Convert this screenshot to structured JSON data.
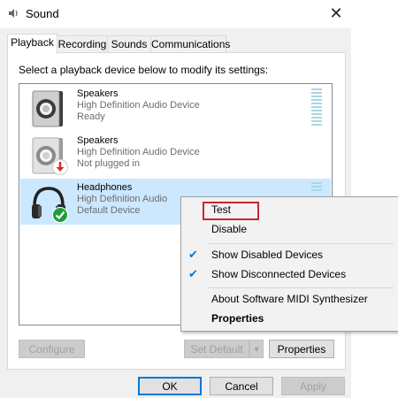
{
  "window": {
    "title": "Sound",
    "close_label": "✕"
  },
  "tabs": [
    {
      "label": "Playback",
      "active": true
    },
    {
      "label": "Recording",
      "active": false
    },
    {
      "label": "Sounds",
      "active": false
    },
    {
      "label": "Communications",
      "active": false
    }
  ],
  "instruction": "Select a playback device below to modify its settings:",
  "devices": [
    {
      "name": "Speakers",
      "description": "High Definition Audio Device",
      "status": "Ready",
      "icon": "speaker-icon",
      "selected": false
    },
    {
      "name": "Speakers",
      "description": "High Definition Audio Device",
      "status": "Not plugged in",
      "icon": "speaker-unplugged-icon",
      "badge": "down-arrow-badge",
      "selected": false
    },
    {
      "name": "Headphones",
      "description": "High Definition Audio",
      "status": "Default Device",
      "icon": "headphones-icon",
      "badge": "check-badge",
      "selected": true
    }
  ],
  "buttons": {
    "configure": "Configure",
    "set_default": "Set Default",
    "set_default_arrow": "▾",
    "properties": "Properties",
    "ok": "OK",
    "cancel": "Cancel",
    "apply": "Apply"
  },
  "context_menu": {
    "items": [
      {
        "label": "Test",
        "checked": false,
        "bold": false,
        "highlighted": true
      },
      {
        "label": "Disable",
        "checked": false,
        "bold": false
      },
      {
        "label": "Show Disabled Devices",
        "checked": true,
        "bold": false
      },
      {
        "label": "Show Disconnected Devices",
        "checked": true,
        "bold": false
      },
      {
        "label": "About Software MIDI Synthesizer",
        "checked": false,
        "bold": false
      },
      {
        "label": "Properties",
        "checked": false,
        "bold": true
      }
    ],
    "check_glyph": "✔"
  },
  "colors": {
    "selection": "#cce8ff",
    "accent": "#0078d7",
    "highlight_box": "#c8262e",
    "badge_green": "#1f9d3a",
    "badge_red": "#d32f2f"
  }
}
